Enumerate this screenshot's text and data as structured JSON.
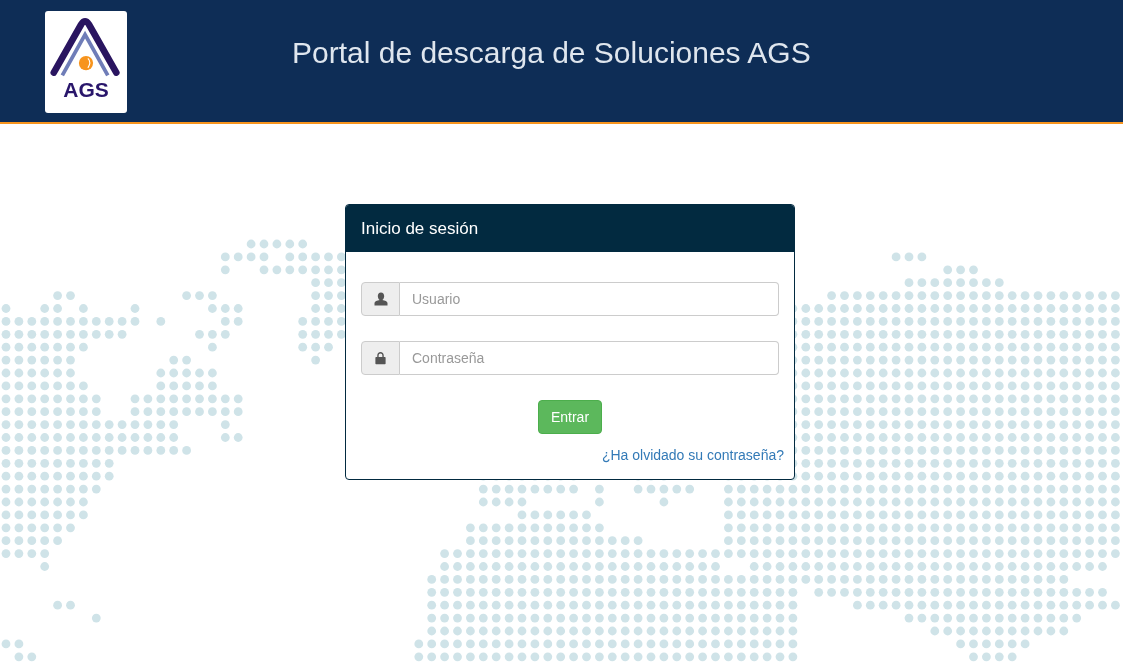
{
  "header": {
    "logo_text": "AGS",
    "title": "Portal de descarga de Soluciones AGS"
  },
  "login_panel": {
    "title": "Inicio de sesión",
    "fields": [
      {
        "kind": "user",
        "placeholder": "Usuario"
      },
      {
        "kind": "password",
        "placeholder": "Contraseña"
      }
    ],
    "submit_button": "Entrar",
    "forgot_link": "¿Ha olvidado su contraseña?"
  }
}
